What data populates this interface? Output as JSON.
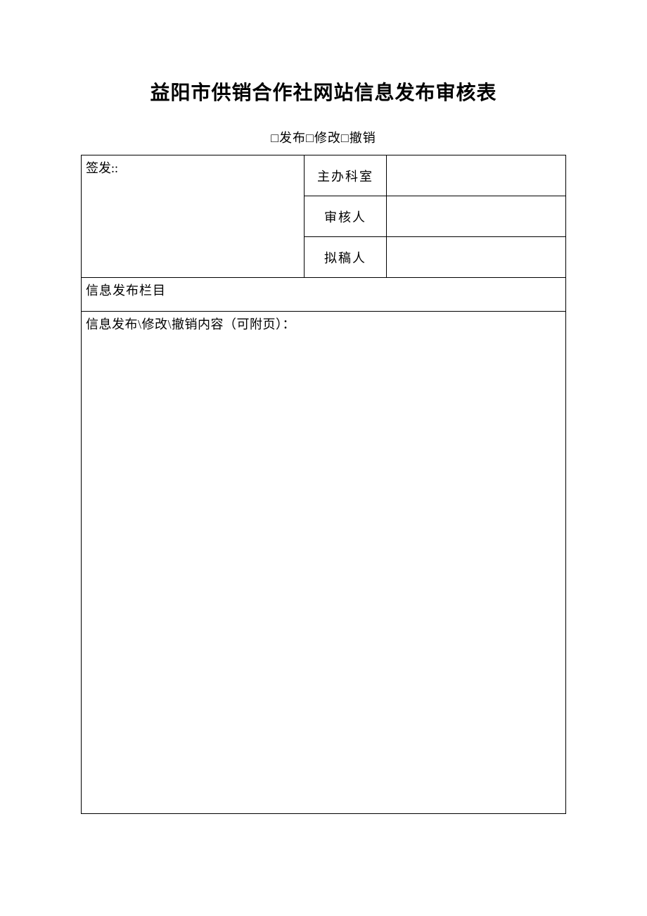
{
  "title": "益阳市供销合作社网站信息发布审核表",
  "subtitle": "□发布□修改□撤销",
  "form": {
    "issuer_label": "签发::",
    "issuer_value": "",
    "rows": [
      {
        "label": "主办科室",
        "value": ""
      },
      {
        "label": "审核人",
        "value": ""
      },
      {
        "label": "拟稿人",
        "value": ""
      }
    ],
    "column_label": "信息发布栏目",
    "column_value": "",
    "content_label": "信息发布\\修改\\撤销内容（可附页）：",
    "content_value": ""
  }
}
